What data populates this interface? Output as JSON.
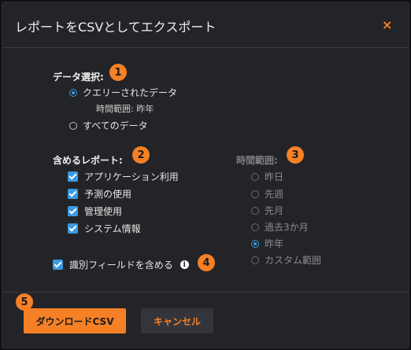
{
  "dialog": {
    "title": "レポートをCSVとしてエクスポート",
    "close_label": "×"
  },
  "data_selection": {
    "heading": "データ選択:",
    "badge": "1",
    "options": [
      {
        "label": "クエリーされたデータ",
        "selected": true
      },
      {
        "label": "すべてのデータ",
        "selected": false
      }
    ],
    "time_range_note": "時間範囲: 昨年"
  },
  "include_reports": {
    "heading": "含めるレポート:",
    "badge": "2",
    "items": [
      {
        "label": "アプリケーション利用",
        "checked": true
      },
      {
        "label": "予測の使用",
        "checked": true
      },
      {
        "label": "管理使用",
        "checked": true
      },
      {
        "label": "システム情報",
        "checked": true
      }
    ]
  },
  "time_range": {
    "heading": "時間範囲:",
    "badge": "3",
    "options": [
      {
        "label": "昨日",
        "selected": false
      },
      {
        "label": "先週",
        "selected": false
      },
      {
        "label": "先月",
        "selected": false
      },
      {
        "label": "過去3か月",
        "selected": false
      },
      {
        "label": "昨年",
        "selected": true
      },
      {
        "label": "カスタム範囲",
        "selected": false
      }
    ]
  },
  "identifying_fields": {
    "label": "識別フィールドを含める",
    "checked": true,
    "info_icon": "i",
    "badge": "4"
  },
  "footer": {
    "badge": "5",
    "download_label": "ダウンロードCSV",
    "cancel_label": "キャンセル"
  },
  "colors": {
    "accent": "#f58025",
    "check": "#3a9ae4",
    "background": "#232427"
  }
}
